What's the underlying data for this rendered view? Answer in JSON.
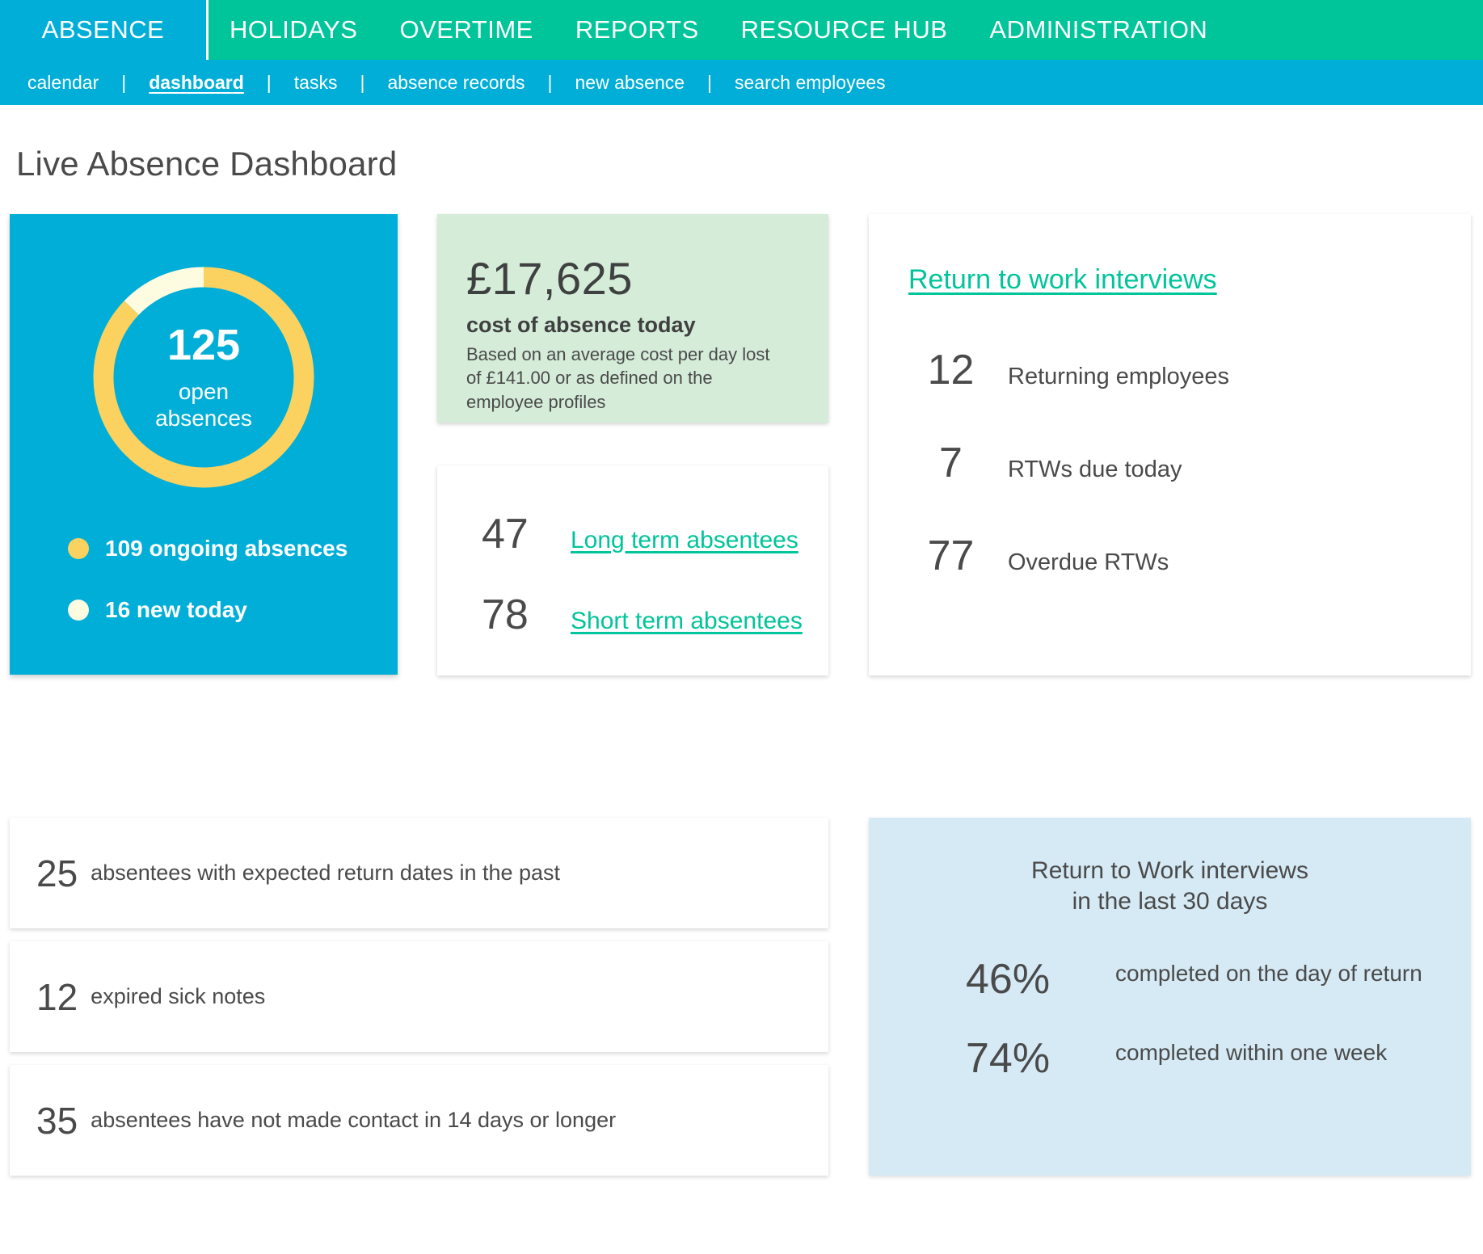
{
  "topnav": {
    "items": [
      {
        "label": "ABSENCE",
        "active": true
      },
      {
        "label": "HOLIDAYS",
        "active": false
      },
      {
        "label": "OVERTIME",
        "active": false
      },
      {
        "label": "REPORTS",
        "active": false
      },
      {
        "label": "RESOURCE HUB",
        "active": false
      },
      {
        "label": "ADMINISTRATION",
        "active": false
      }
    ],
    "active_color": "#00aed8",
    "bar_color": "#00c49a"
  },
  "subnav": {
    "separator": "|",
    "items": [
      {
        "label": "calendar",
        "active": false
      },
      {
        "label": "dashboard",
        "active": true
      },
      {
        "label": "tasks",
        "active": false
      },
      {
        "label": "absence records",
        "active": false
      },
      {
        "label": "new absence",
        "active": false
      },
      {
        "label": "search employees",
        "active": false
      }
    ],
    "bg_color": "#00aed8"
  },
  "page": {
    "title": "Live Absence Dashboard"
  },
  "donut_card": {
    "center_value": "125",
    "center_label_line1": "open",
    "center_label_line2": "absences",
    "legend": [
      {
        "label": "109 ongoing absences",
        "color": "#fbd25f"
      },
      {
        "label": "16 new today",
        "color": "#fdfbe0"
      }
    ]
  },
  "chart_data": {
    "type": "pie",
    "title": "125 open absences",
    "categories": [
      "109 ongoing absences",
      "16 new today"
    ],
    "values": [
      109,
      16
    ],
    "colors": [
      "#fbd25f",
      "#fdfbe0"
    ],
    "total": 125,
    "legend_position": "bottom-left",
    "donut": true,
    "background": "#00aed8"
  },
  "cost_card": {
    "amount": "£17,625",
    "subtitle": "cost of absence today",
    "description": "Based on an average cost per day lost of £141.00 or as defined on the employee profiles",
    "bg_color": "#d5ecd9"
  },
  "absentees_card": {
    "rows": [
      {
        "value": "47",
        "link": "Long term absentees"
      },
      {
        "value": "78",
        "link": "Short term absentees"
      }
    ],
    "link_color": "#00c49a"
  },
  "rtw_card": {
    "title": "Return to work interviews",
    "rows": [
      {
        "value": "12",
        "label": "Returning employees"
      },
      {
        "value": "7",
        "label": "RTWs due today"
      },
      {
        "value": "77",
        "label": "Overdue RTWs"
      }
    ]
  },
  "info_cards": [
    {
      "value": "25",
      "text": "absentees with expected return dates in the past"
    },
    {
      "value": "12",
      "text": "expired sick notes"
    },
    {
      "value": "35",
      "text": "absentees have not made contact in 14 days or longer"
    }
  ],
  "rtw_stats_card": {
    "heading_line1": "Return to Work interviews",
    "heading_line2": "in the last 30 days",
    "rows": [
      {
        "value": "46%",
        "label": "completed on the day of return"
      },
      {
        "value": "74%",
        "label": "completed within one week"
      }
    ],
    "bg_color": "#d6eaf5"
  }
}
